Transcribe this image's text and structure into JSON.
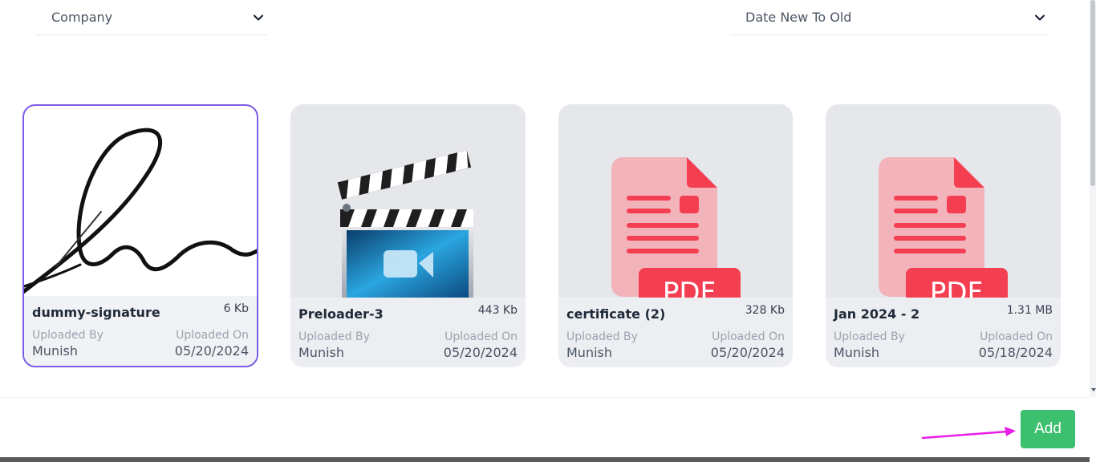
{
  "filters": {
    "company_label": "Company",
    "sort_label": "Date New To Old"
  },
  "files": [
    {
      "name": "dummy-signature",
      "size": "6 Kb",
      "uploaded_by_label": "Uploaded By",
      "uploaded_by": "Munish",
      "uploaded_on_label": "Uploaded On",
      "uploaded_on": "05/20/2024",
      "thumb": "signature-image",
      "selected": true
    },
    {
      "name": "Preloader-3",
      "size": "443 Kb",
      "uploaded_by_label": "Uploaded By",
      "uploaded_by": "Munish",
      "uploaded_on_label": "Uploaded On",
      "uploaded_on": "05/20/2024",
      "thumb": "video-clapper-icon"
    },
    {
      "name": "certificate (2)",
      "size": "328 Kb",
      "uploaded_by_label": "Uploaded By",
      "uploaded_by": "Munish",
      "uploaded_on_label": "Uploaded On",
      "uploaded_on": "05/20/2024",
      "thumb": "pdf-file-icon",
      "thumb_text": "PDF"
    },
    {
      "name": "Jan 2024 - 2",
      "size": "1.31 MB",
      "uploaded_by_label": "Uploaded By",
      "uploaded_by": "Munish",
      "uploaded_on_label": "Uploaded On",
      "uploaded_on": "05/18/2024",
      "thumb": "pdf-file-icon",
      "thumb_text": "PDF"
    }
  ],
  "footer": {
    "add_label": "Add"
  },
  "colors": {
    "accent_green": "#3cbf6e",
    "selected_border": "#7c5ce6",
    "annotation_arrow": "#e81ee8",
    "pdf_red": "#f43f52"
  }
}
